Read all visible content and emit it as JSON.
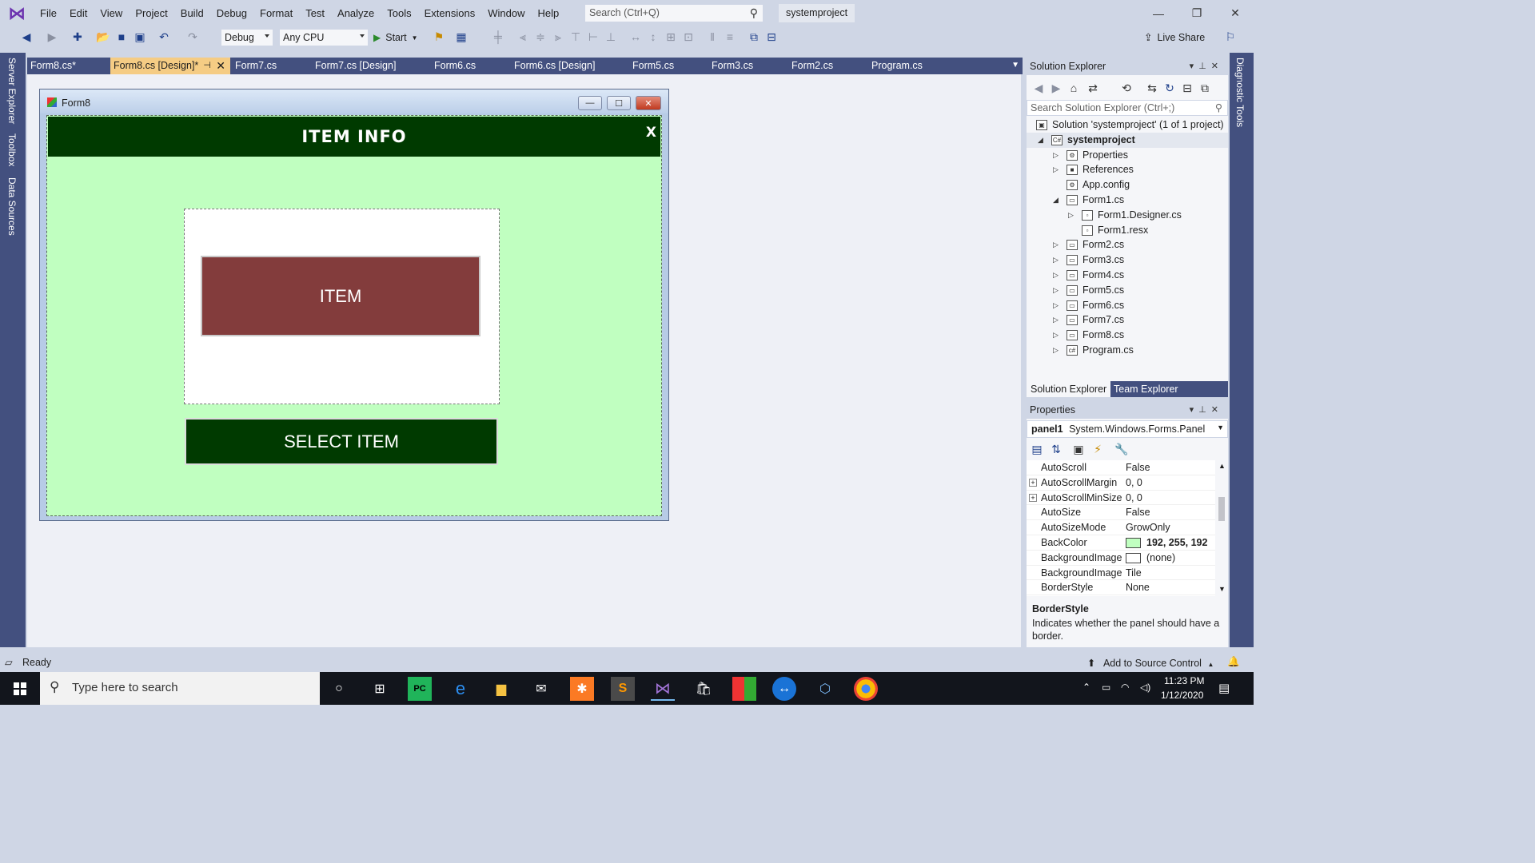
{
  "menu": {
    "items": [
      "File",
      "Edit",
      "View",
      "Project",
      "Build",
      "Debug",
      "Format",
      "Test",
      "Analyze",
      "Tools",
      "Extensions",
      "Window",
      "Help"
    ],
    "search_placeholder": "Search (Ctrl+Q)",
    "solution_name": "systemproject"
  },
  "toolbar": {
    "config": "Debug",
    "platform": "Any CPU",
    "start_label": "Start",
    "live_share": "Live Share"
  },
  "left_strip": [
    "Server Explorer",
    "Toolbox",
    "Data Sources"
  ],
  "right_strip": [
    "Diagnostic Tools"
  ],
  "doc_tabs": [
    "Form8.cs*",
    "Form8.cs [Design]*",
    "Form7.cs",
    "Form7.cs [Design]",
    "Form6.cs",
    "Form6.cs [Design]",
    "Form5.cs",
    "Form3.cs",
    "Form2.cs",
    "Program.cs"
  ],
  "form": {
    "title": "Form8",
    "header_title": "ITEM INFO",
    "header_close": "X",
    "item_button": "ITEM",
    "select_button": "SELECT ITEM"
  },
  "solution_explorer": {
    "title": "Solution Explorer",
    "search_placeholder": "Search Solution Explorer (Ctrl+;)",
    "tree": [
      {
        "label": "Solution 'systemproject' (1 of 1 project)",
        "level": 0,
        "expander": "",
        "icon": "solution-icon"
      },
      {
        "label": "systemproject",
        "level": 0,
        "expander": "◢",
        "icon": "csharp-project-icon",
        "bold": true
      },
      {
        "label": "Properties",
        "level": 1,
        "expander": "▷",
        "icon": "wrench-icon"
      },
      {
        "label": "References",
        "level": 1,
        "expander": "▷",
        "icon": "references-icon"
      },
      {
        "label": "App.config",
        "level": 1,
        "expander": "",
        "icon": "config-file-icon"
      },
      {
        "label": "Form1.cs",
        "level": 1,
        "expander": "◢",
        "icon": "form-icon"
      },
      {
        "label": "Form1.Designer.cs",
        "level": 2,
        "expander": "▷",
        "icon": "file-icon"
      },
      {
        "label": "Form1.resx",
        "level": 2,
        "expander": "",
        "icon": "file-icon"
      },
      {
        "label": "Form2.cs",
        "level": 1,
        "expander": "▷",
        "icon": "form-icon"
      },
      {
        "label": "Form3.cs",
        "level": 1,
        "expander": "▷",
        "icon": "form-icon"
      },
      {
        "label": "Form4.cs",
        "level": 1,
        "expander": "▷",
        "icon": "form-icon"
      },
      {
        "label": "Form5.cs",
        "level": 1,
        "expander": "▷",
        "icon": "form-icon"
      },
      {
        "label": "Form6.cs",
        "level": 1,
        "expander": "▷",
        "icon": "form-icon"
      },
      {
        "label": "Form7.cs",
        "level": 1,
        "expander": "▷",
        "icon": "form-icon"
      },
      {
        "label": "Form8.cs",
        "level": 1,
        "expander": "▷",
        "icon": "form-icon"
      },
      {
        "label": "Program.cs",
        "level": 1,
        "expander": "▷",
        "icon": "csharp-file-icon"
      }
    ],
    "bottom_tabs": [
      "Solution Explorer",
      "Team Explorer"
    ]
  },
  "properties": {
    "title": "Properties",
    "object_name": "panel1",
    "object_type": "System.Windows.Forms.Panel",
    "rows": [
      {
        "name": "AutoScroll",
        "value": "False"
      },
      {
        "name": "AutoScrollMargin",
        "value": "0, 0",
        "expandable": true
      },
      {
        "name": "AutoScrollMinSize",
        "value": "0, 0",
        "expandable": true
      },
      {
        "name": "AutoSize",
        "value": "False"
      },
      {
        "name": "AutoSizeMode",
        "value": "GrowOnly"
      },
      {
        "name": "BackColor",
        "value": "192, 255, 192",
        "swatch": "#c0ffc0",
        "bold": true
      },
      {
        "name": "BackgroundImage",
        "value": "(none)",
        "swatch": "#ffffff"
      },
      {
        "name": "BackgroundImageLayout",
        "value": "Tile"
      },
      {
        "name": "BorderStyle",
        "value": "None"
      }
    ],
    "desc_title": "BorderStyle",
    "desc_text": "Indicates whether the panel should have a border."
  },
  "status": {
    "text": "Ready",
    "source_control": "Add to Source Control"
  },
  "taskbar": {
    "search_placeholder": "Type here to search",
    "time": "11:23 PM",
    "date": "1/12/2020"
  },
  "colors": {
    "panel_bg": "#c0ffc0",
    "header_bg": "#003a00",
    "item_bg": "#833c3c",
    "active_tab": "#f5cc84",
    "chrome": "#cfd6e5",
    "strip": "#43507f"
  }
}
